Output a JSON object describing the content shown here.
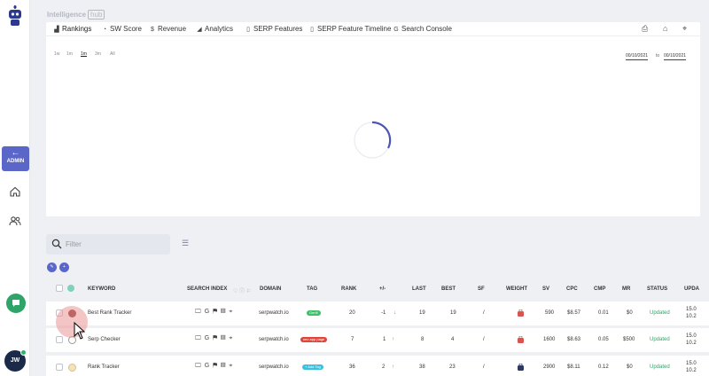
{
  "brand": {
    "name": "Intelligence",
    "badge": "hub"
  },
  "sidebar": {
    "admin_label": "ADMIN",
    "avatar_initials": "JW"
  },
  "tabs": [
    {
      "label": "Rankings",
      "icon": "bar-chart-icon"
    },
    {
      "label": "SW Score",
      "icon": "gauge-icon"
    },
    {
      "label": "Revenue",
      "icon": "dollar-icon"
    },
    {
      "label": "Analytics",
      "icon": "signal-icon"
    },
    {
      "label": "SERP Features",
      "icon": "bookmark-icon"
    },
    {
      "label": "SERP Feature Timeline",
      "icon": "bookmark-icon"
    },
    {
      "label": "Search Console",
      "icon": "google-icon"
    }
  ],
  "ranges": [
    "1w",
    "1m",
    "1m",
    "3m",
    "All"
  ],
  "dates": {
    "from": "00/10/2021",
    "to_label": "to",
    "to": "00/10/2021"
  },
  "filter": {
    "placeholder": "Filter"
  },
  "table": {
    "headers": {
      "keyword": "KEYWORD",
      "search_index": "SEARCH INDEX",
      "domain": "DOMAIN",
      "tag": "TAG",
      "rank": "RANK",
      "change": "+/-",
      "last": "LAST",
      "best": "BEST",
      "sf": "SF",
      "weight": "WEIGHT",
      "sv": "SV",
      "cpc": "CPC",
      "cmp": "CMP",
      "mr": "MR",
      "status": "STATUS",
      "updated": "UPDA"
    },
    "rows": [
      {
        "keyword": "Best Rank Tracker",
        "domain": "serpwatch.io",
        "tag": "Gerfil",
        "tag_color": "#3fbf6a",
        "rank": "20",
        "change": "-1",
        "change_dir": "down",
        "last": "19",
        "best": "19",
        "sf": "/",
        "weight_color": "#d9534f",
        "sv": "590",
        "cpc": "$8.57",
        "cmp": "0.01",
        "mr": "$0",
        "status": "Updated",
        "updated": "15.0\n10.2"
      },
      {
        "keyword": "Serp Checker",
        "domain": "serpwatch.io",
        "tag": "seo app page",
        "tag_color": "#e0453a",
        "rank": "7",
        "change": "1",
        "change_dir": "up",
        "last": "8",
        "best": "4",
        "sf": "/",
        "weight_color": "#d9534f",
        "sv": "1600",
        "cpc": "$8.63",
        "cmp": "0.05",
        "mr": "$500",
        "status": "Updated",
        "updated": "15.0\n10.2"
      },
      {
        "keyword": "Rank Tracker",
        "domain": "serpwatch.io",
        "tag": "+ Add Tag",
        "tag_color": "#3cc0e0",
        "rank": "36",
        "change": "2",
        "change_dir": "up",
        "last": "38",
        "best": "23",
        "sf": "/",
        "weight_color": "#2b3a5e",
        "sv": "2900",
        "cpc": "$8.11",
        "cmp": "0.12",
        "mr": "$0",
        "status": "Updated",
        "updated": "15.0\n10.2"
      }
    ]
  }
}
